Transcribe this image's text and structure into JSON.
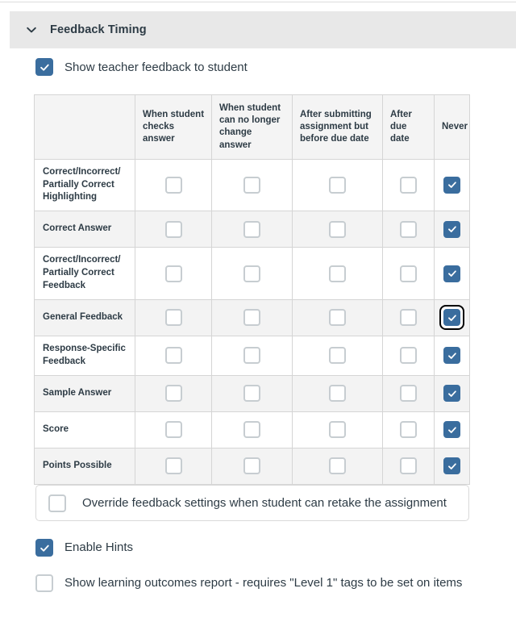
{
  "section": {
    "title": "Feedback Timing",
    "chevron_icon": "chevron-down-icon",
    "expanded": true
  },
  "show_teacher_feedback": {
    "label": "Show teacher feedback to student",
    "checked": true
  },
  "table": {
    "corner_header": "",
    "columns": [
      "When student checks answer",
      "When student can no longer change answer",
      "After submitting assignment but before due date",
      "After due date",
      "Never"
    ],
    "rows": [
      {
        "label": "Correct/Incorrect/ Partially Correct Highlighting",
        "checks": [
          false,
          false,
          false,
          false,
          true
        ],
        "focused_index": -1
      },
      {
        "label": "Correct Answer",
        "checks": [
          false,
          false,
          false,
          false,
          true
        ],
        "focused_index": -1
      },
      {
        "label": "Correct/Incorrect/ Partially Correct Feedback",
        "checks": [
          false,
          false,
          false,
          false,
          true
        ],
        "focused_index": -1
      },
      {
        "label": "General Feedback",
        "checks": [
          false,
          false,
          false,
          false,
          true
        ],
        "focused_index": 4
      },
      {
        "label": "Response-Specific Feedback",
        "checks": [
          false,
          false,
          false,
          false,
          true
        ],
        "focused_index": -1
      },
      {
        "label": "Sample Answer",
        "checks": [
          false,
          false,
          false,
          false,
          true
        ],
        "focused_index": -1
      },
      {
        "label": "Score",
        "checks": [
          false,
          false,
          false,
          false,
          true
        ],
        "focused_index": -1
      },
      {
        "label": "Points Possible",
        "checks": [
          false,
          false,
          false,
          false,
          true
        ],
        "focused_index": -1
      }
    ]
  },
  "override": {
    "label": "Override feedback settings when student can retake the assignment",
    "checked": false
  },
  "enable_hints": {
    "label": "Enable Hints",
    "checked": true
  },
  "learning_outcomes": {
    "label": "Show learning outcomes report - requires \"Level 1\" tags to be set on items",
    "checked": false
  },
  "colors": {
    "checkbox_checked": "#3a6d9e",
    "checkbox_border": "#c7cdd1",
    "header_bar": "#e8e8e8",
    "table_header_bg": "#f4f4f4",
    "row_alt_bg": "#f3f3f3",
    "border": "#d5d5d5",
    "text": "#2d3b45",
    "focus_ring": "#000000"
  }
}
